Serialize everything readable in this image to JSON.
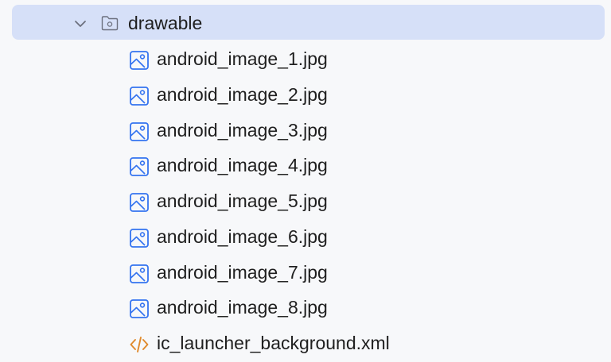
{
  "tree": {
    "folder": {
      "name": "drawable",
      "icon": "folder-icon",
      "expanded": true,
      "selected_bg": "#d6e0f8"
    },
    "files": [
      {
        "name": "android_image_1.jpg",
        "icon": "image-file-icon"
      },
      {
        "name": "android_image_2.jpg",
        "icon": "image-file-icon"
      },
      {
        "name": "android_image_3.jpg",
        "icon": "image-file-icon"
      },
      {
        "name": "android_image_4.jpg",
        "icon": "image-file-icon"
      },
      {
        "name": "android_image_5.jpg",
        "icon": "image-file-icon"
      },
      {
        "name": "android_image_6.jpg",
        "icon": "image-file-icon"
      },
      {
        "name": "android_image_7.jpg",
        "icon": "image-file-icon"
      },
      {
        "name": "android_image_8.jpg",
        "icon": "image-file-icon"
      },
      {
        "name": "ic_launcher_background.xml",
        "icon": "xml-file-icon"
      }
    ]
  },
  "colors": {
    "image_icon": "#3574f0",
    "xml_icon": "#e08a2c",
    "text": "#1f1f1f"
  }
}
